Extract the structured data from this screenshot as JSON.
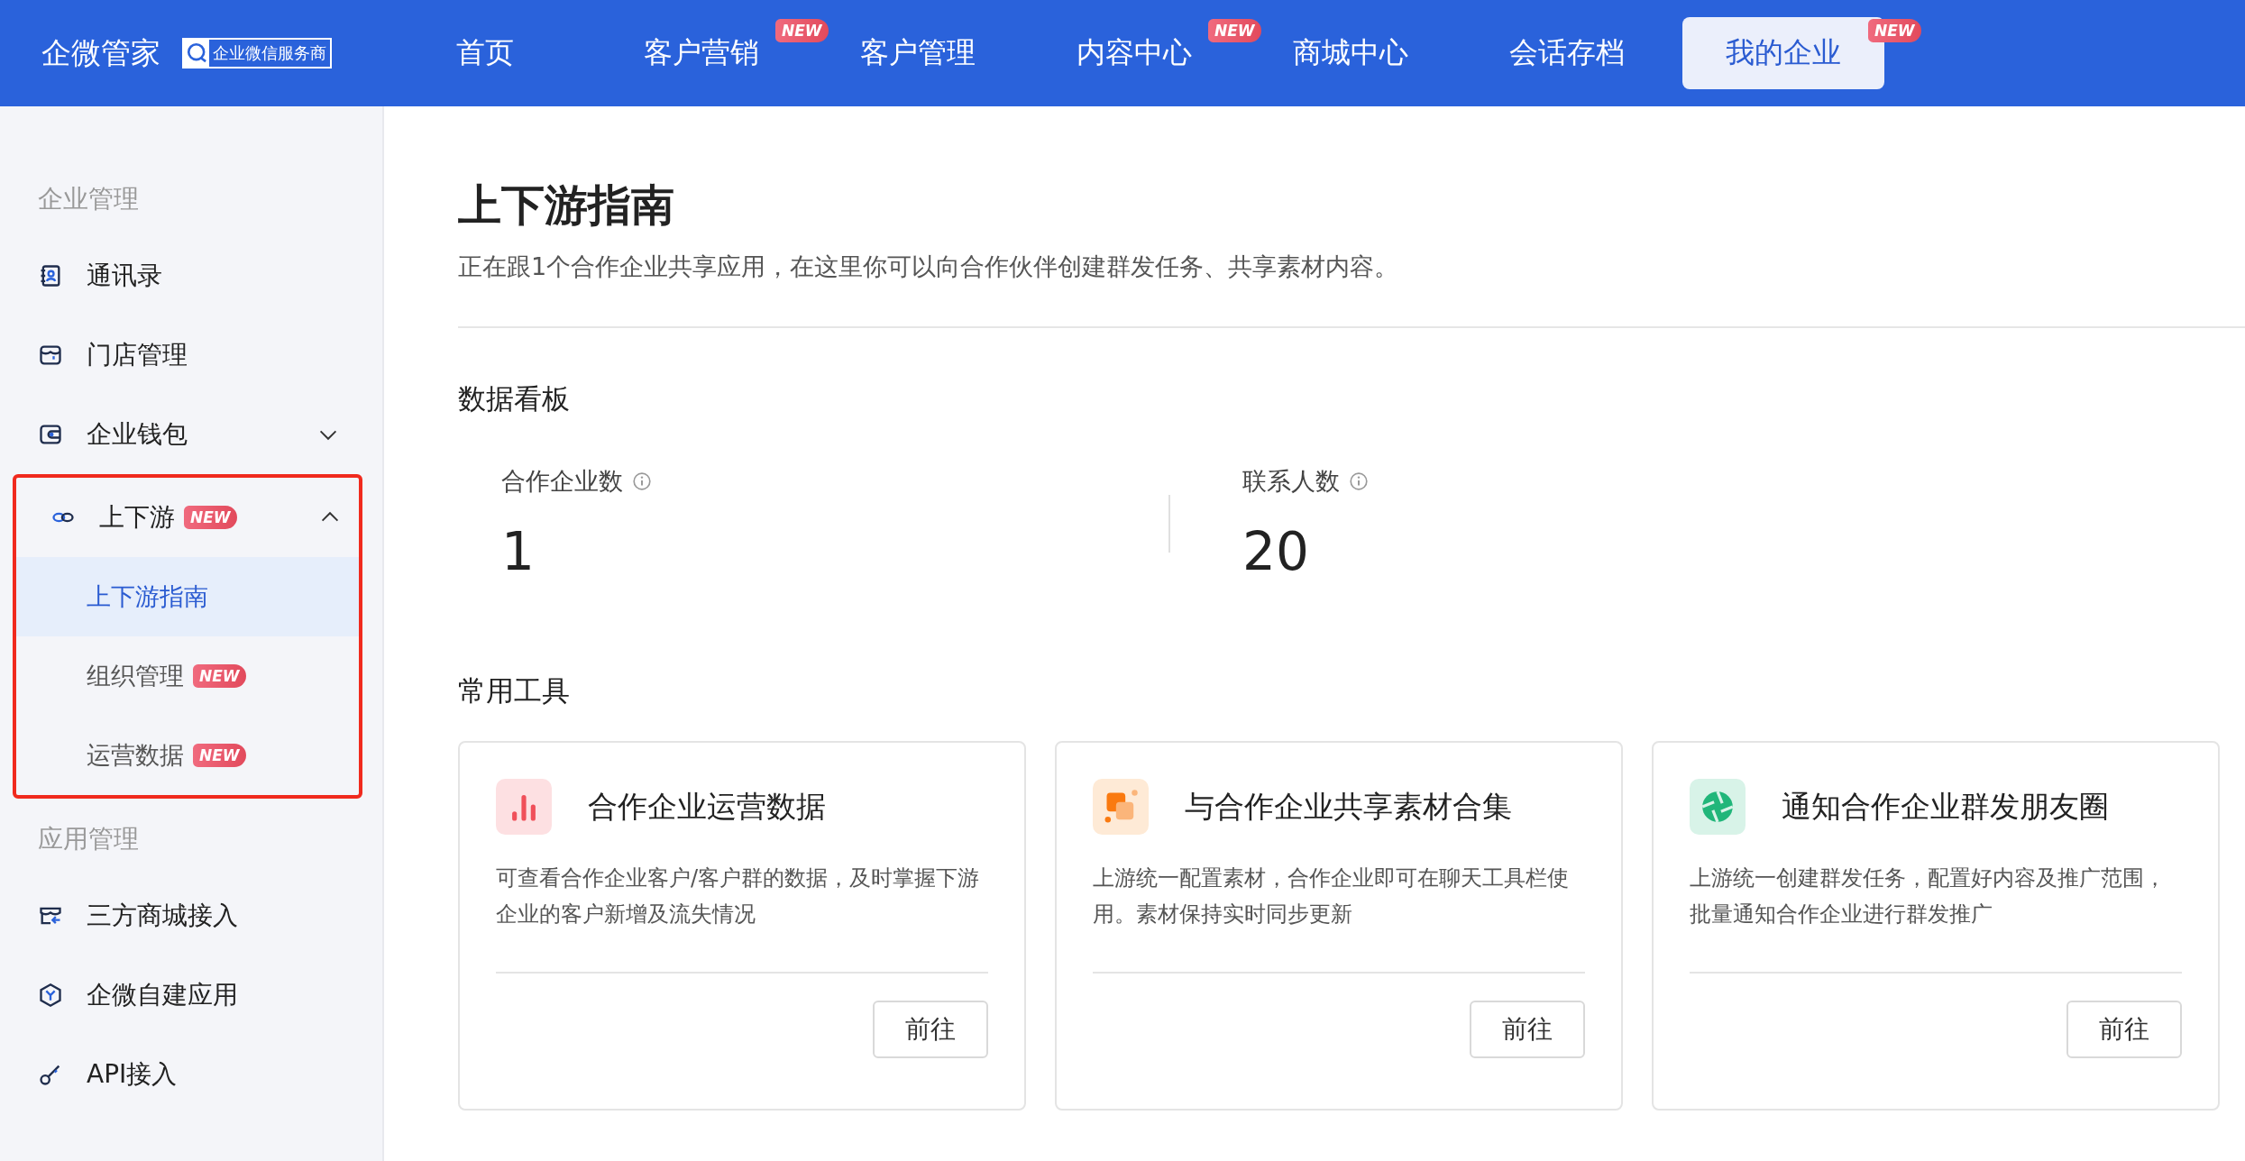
{
  "header": {
    "brand": "企微管家",
    "brand_tag": "企业微信服务商",
    "nav": [
      {
        "label": "首页",
        "selected": false
      },
      {
        "label": "客户营销",
        "selected": false,
        "badge": "NEW"
      },
      {
        "label": "客户管理",
        "selected": false
      },
      {
        "label": "内容中心",
        "selected": false,
        "badge": "NEW"
      },
      {
        "label": "商城中心",
        "selected": false
      },
      {
        "label": "会话存档",
        "selected": false
      },
      {
        "label": "我的企业",
        "selected": true,
        "badge": "NEW"
      }
    ]
  },
  "sidebar": {
    "sections": [
      {
        "title": "企业管理",
        "items": [
          {
            "label": "通讯录",
            "selected": false
          },
          {
            "label": "门店管理",
            "selected": false
          },
          {
            "label": "企业钱包",
            "selected": false,
            "expanded": false
          },
          {
            "label": "上下游",
            "badge": "NEW",
            "selected": false,
            "expanded": true,
            "highlighted": true,
            "children": [
              {
                "label": "上下游指南",
                "selected": true
              },
              {
                "label": "组织管理",
                "selected": false,
                "badge": "NEW"
              },
              {
                "label": "运营数据",
                "selected": false,
                "badge": "NEW"
              }
            ]
          }
        ]
      },
      {
        "title": "应用管理",
        "items": [
          {
            "label": "三方商城接入",
            "selected": false
          },
          {
            "label": "企微自建应用",
            "selected": false
          },
          {
            "label": "API接入",
            "selected": false
          }
        ]
      }
    ]
  },
  "page": {
    "title": "上下游指南",
    "subtitle": "正在跟1个合作企业共享应用，在这里你可以向合作伙伴创建群发任务、共享素材内容。",
    "dashboard": {
      "title": "数据看板",
      "stats": [
        {
          "label": "合作企业数",
          "value": "1"
        },
        {
          "label": "联系人数",
          "value": "20"
        }
      ]
    },
    "tools": {
      "title": "常用工具",
      "cards": [
        {
          "title": "合作企业运营数据",
          "description": "可查看合作企业客户/客户群的数据，及时掌握下游企业的客户新增及流失情况",
          "button": "前往"
        },
        {
          "title": "与合作企业共享素材合集",
          "description": "上游统一配置素材，合作企业即可在聊天工具栏使用。素材保持实时同步更新",
          "button": "前往"
        },
        {
          "title": "通知合作企业群发朋友圈",
          "description": "上游统一创建群发任务，配置好内容及推广范围，批量通知合作企业进行群发推广",
          "button": "前往"
        }
      ]
    }
  }
}
